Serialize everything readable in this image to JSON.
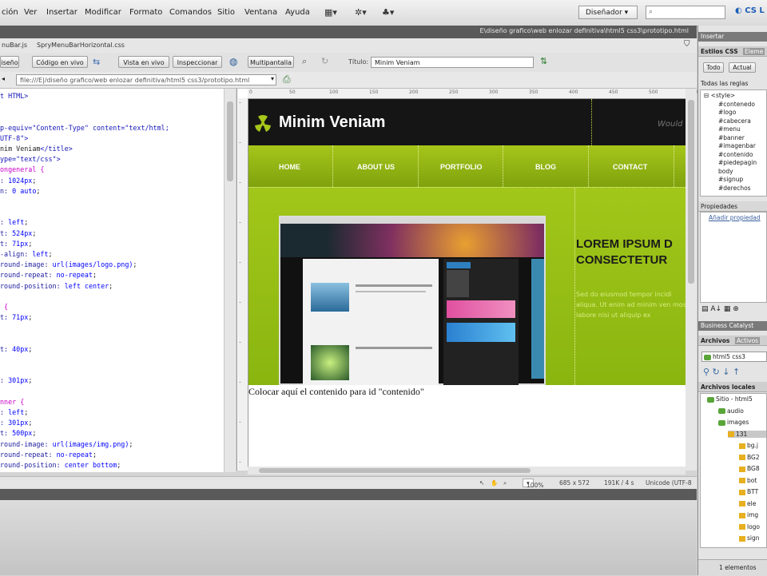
{
  "menubar": {
    "items": [
      "ción",
      "Ver",
      "Insertar",
      "Modificar",
      "Formato",
      "Comandos",
      "Sitio",
      "Ventana",
      "Ayuda"
    ],
    "workspace": "Diseñador",
    "cs_live": "CS L"
  },
  "doc_tab": {
    "path": "E\\diseño grafico\\web enlozar definitiva\\html5 css3\\prototipo.html"
  },
  "related_files": [
    "nuBar.js",
    "SpryMenuBarHorizontal.css"
  ],
  "doc_toolbar": {
    "buttons": [
      "iseño",
      "Código en vivo",
      "Vista en vivo",
      "Inspeccionar",
      "Multipantalla"
    ],
    "title_label": "Título:",
    "title_value": "Minim Veniam"
  },
  "address": {
    "value": "file:///E|/diseño grafico/web enlozar definitiva/html5 css3/prototipo.html"
  },
  "code_lines": [
    [
      [
        "c-tag",
        "t HTML>"
      ]
    ],
    [],
    [],
    [
      [
        "c-tag",
        "p-equiv=\"Content-Type\" content=\"text/html;"
      ]
    ],
    [
      [
        "c-tag",
        "UTF-8\">"
      ]
    ],
    [
      [
        "",
        "nim Veniam"
      ],
      [
        "c-tag",
        "</title>"
      ]
    ],
    [
      [
        "c-tag",
        "ype=\"text/css\">"
      ]
    ],
    [
      [
        "c-sel",
        "ongeneral {"
      ]
    ],
    [
      [
        "c-prop",
        ": "
      ],
      [
        "c-val",
        "1024px"
      ],
      [
        "",
        "; "
      ]
    ],
    [
      [
        "c-prop",
        "n: "
      ],
      [
        "c-val",
        "0 auto"
      ],
      [
        "",
        ";"
      ]
    ],
    [],
    [],
    [
      [
        "c-prop",
        ": "
      ],
      [
        "c-val",
        "left"
      ],
      [
        "",
        ";"
      ]
    ],
    [
      [
        "c-prop",
        "t: "
      ],
      [
        "c-val",
        "524px"
      ],
      [
        "",
        ";"
      ]
    ],
    [
      [
        "c-prop",
        "t: "
      ],
      [
        "c-val",
        "71px"
      ],
      [
        "",
        ";"
      ]
    ],
    [
      [
        "c-prop",
        "-align: "
      ],
      [
        "c-val",
        "left"
      ],
      [
        "",
        ";"
      ]
    ],
    [
      [
        "c-prop",
        "round-image: "
      ],
      [
        "c-val",
        "url(images/logo.png)"
      ],
      [
        "",
        ";"
      ]
    ],
    [
      [
        "c-prop",
        "round-repeat: "
      ],
      [
        "c-val",
        "no-repeat"
      ],
      [
        "",
        ";"
      ]
    ],
    [
      [
        "c-prop",
        "round-position: "
      ],
      [
        "c-val",
        "left center"
      ],
      [
        "",
        ";"
      ]
    ],
    [],
    [
      [
        "c-sel",
        " {"
      ]
    ],
    [
      [
        "c-prop",
        "t: "
      ],
      [
        "c-val",
        "71px"
      ],
      [
        "",
        ";"
      ]
    ],
    [],
    [],
    [
      [
        "c-prop",
        "t: "
      ],
      [
        "c-val",
        "40px"
      ],
      [
        "",
        ";"
      ]
    ],
    [],
    [],
    [
      [
        "c-prop",
        ": "
      ],
      [
        "c-val",
        "301px"
      ],
      [
        "",
        ";"
      ]
    ],
    [],
    [
      [
        "c-sel",
        "nner {"
      ]
    ],
    [
      [
        "c-prop",
        ": "
      ],
      [
        "c-val",
        "left"
      ],
      [
        "",
        ";"
      ]
    ],
    [
      [
        "c-prop",
        ": "
      ],
      [
        "c-val",
        "301px"
      ],
      [
        "",
        ";"
      ]
    ],
    [
      [
        "c-prop",
        "t: "
      ],
      [
        "c-val",
        "500px"
      ],
      [
        "",
        ";"
      ]
    ],
    [
      [
        "c-prop",
        "round-image: "
      ],
      [
        "c-val",
        "url(images/img.png)"
      ],
      [
        "",
        ";"
      ]
    ],
    [
      [
        "c-prop",
        "round-repeat: "
      ],
      [
        "c-val",
        "no-repeat"
      ],
      [
        "",
        ";"
      ]
    ],
    [
      [
        "c-prop",
        "round-position: "
      ],
      [
        "c-val",
        "center bottom"
      ],
      [
        "",
        ";"
      ]
    ]
  ],
  "site": {
    "logo": "Minim Veniam",
    "tagline": "Would",
    "nav": [
      "HOME",
      "ABOUT US",
      "PORTFOLIO",
      "BLOG",
      "CONTACT"
    ],
    "headline_1": "LOREM IPSUM D",
    "headline_2": "CONSECTETUR",
    "body_text": "Sed do eiusmod tempor incidi aliqua. Ut enim ad minim ven mos labore nisi ut aliquip ex",
    "placeholder": "Colocar aquí el contenido para id \"contenido\""
  },
  "statusbar": {
    "zoom": "100%",
    "size": "685 x 572",
    "weight": "191K / 4 s",
    "encoding": "Unicode (UTF-8"
  },
  "right_panel": {
    "top_tab": "Insertar",
    "css_tabs": [
      "Estilos CSS",
      "Eleme"
    ],
    "mode_tabs": [
      "Todo",
      "Actual"
    ],
    "all_rules_label": "Todas las reglas",
    "rules": [
      "<style>",
      "#contenedo",
      "#logo",
      "#cabecera",
      "#menu",
      "#banner",
      "#imagenbar",
      "#contenido",
      "#piedepagin",
      "body",
      "#signup",
      "#derechos"
    ],
    "properties_label": "Propiedades",
    "add_property": "Añadir propiedad",
    "bc_label": "Business Catalyst",
    "files_tabs": [
      "Archivos",
      "Activos"
    ],
    "site_select": "html5 css3",
    "local_files_label": "Archivos locales",
    "tree": [
      "Sitio - html5",
      "audio",
      "images",
      "131",
      "bg.j",
      "BG2",
      "BG8",
      "bot",
      "BTT",
      "ele",
      "img",
      "logo",
      "sign"
    ],
    "footer": "1 elementos"
  }
}
